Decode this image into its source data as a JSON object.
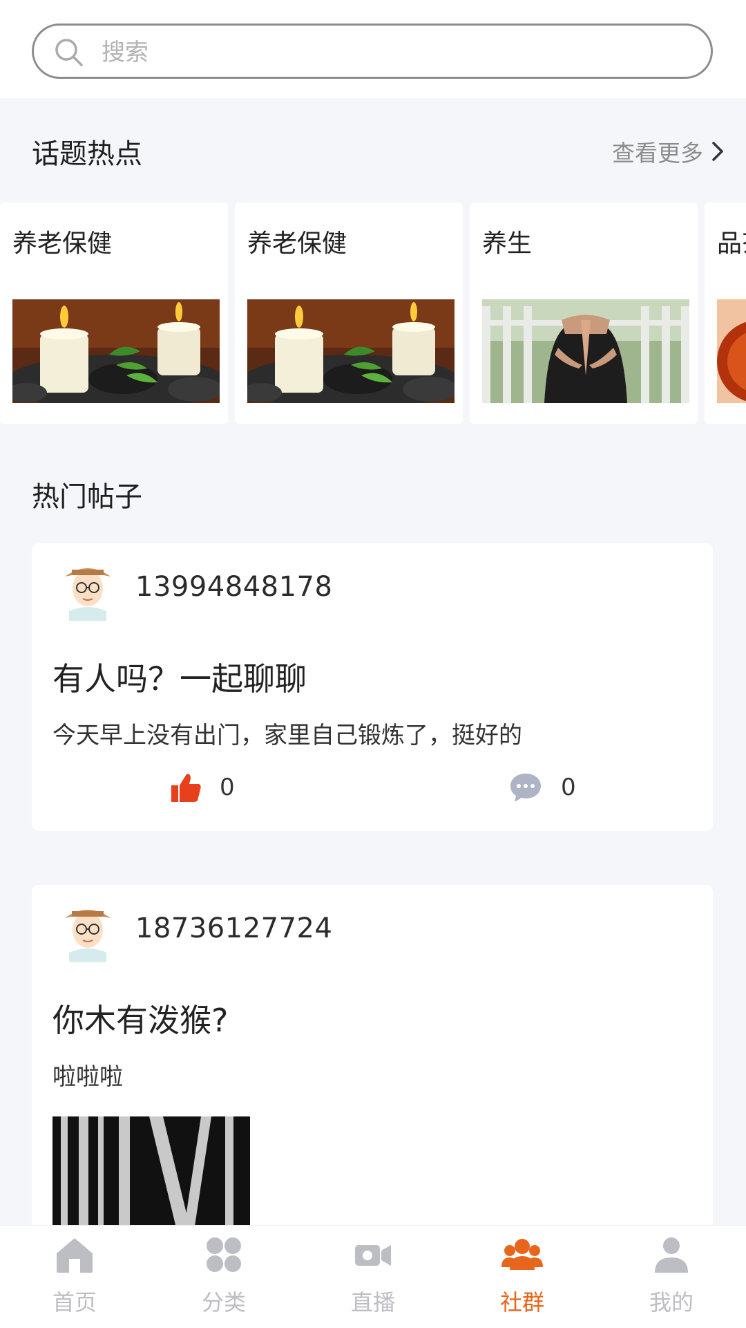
{
  "search": {
    "placeholder": "搜索"
  },
  "topics": {
    "title": "话题热点",
    "more_label": "查看更多",
    "items": [
      {
        "label": "养老保健",
        "image": "candles-stones"
      },
      {
        "label": "养老保健",
        "image": "candles-stones"
      },
      {
        "label": "养生",
        "image": "yoga-pose"
      },
      {
        "label": "品茶",
        "image": "tea"
      }
    ]
  },
  "posts": {
    "title": "热门帖子",
    "items": [
      {
        "username": "13994848178",
        "title": "有人吗？一起聊聊",
        "body": "今天早上没有出门，家里自己锻炼了，挺好的",
        "likes": "0",
        "comments": "0"
      },
      {
        "username": "18736127724",
        "title": "你木有泼猴?",
        "body": "啦啦啦",
        "image": "black-white-pattern"
      }
    ]
  },
  "nav": {
    "items": [
      {
        "label": "首页",
        "icon": "home-icon"
      },
      {
        "label": "分类",
        "icon": "grid-icon"
      },
      {
        "label": "直播",
        "icon": "video-camera-icon"
      },
      {
        "label": "社群",
        "icon": "community-icon",
        "active": true
      },
      {
        "label": "我的",
        "icon": "person-icon"
      }
    ]
  },
  "colors": {
    "accent": "#e8661c",
    "like": "#e8401c",
    "inactive": "#bdbdc4"
  }
}
